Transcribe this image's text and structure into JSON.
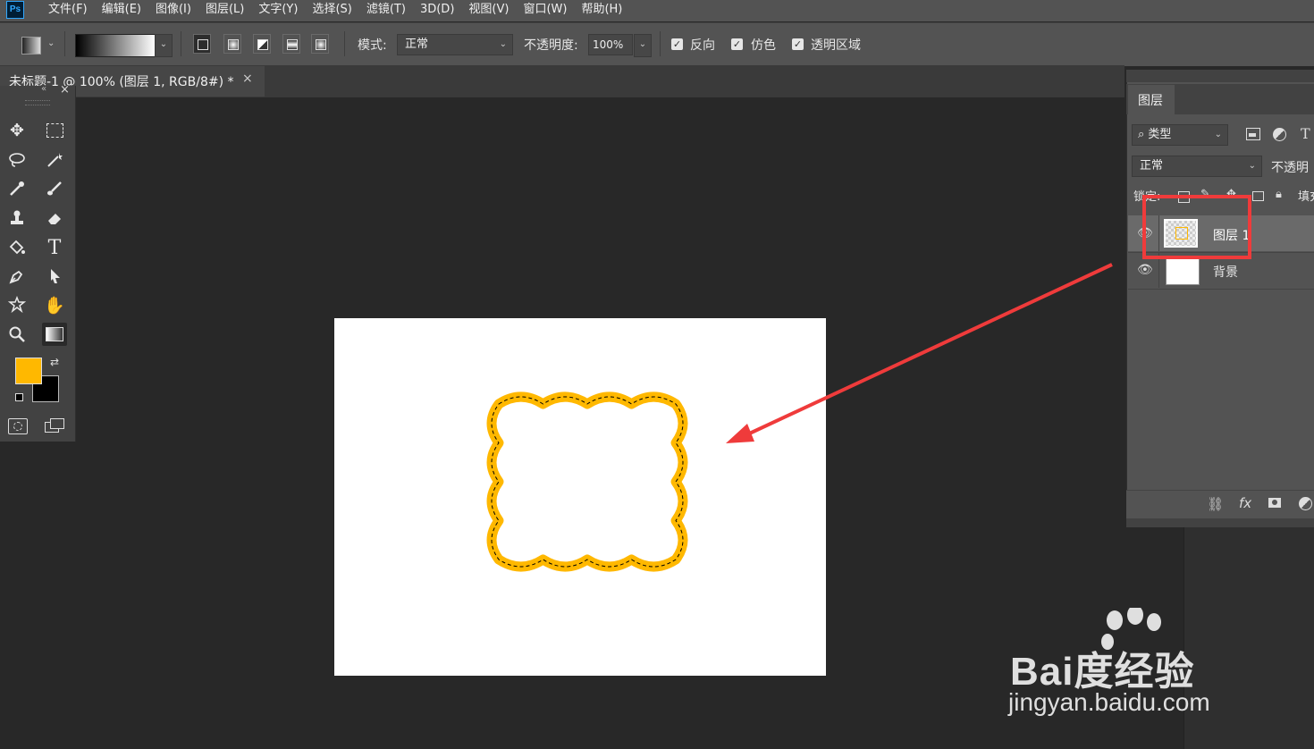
{
  "app": {
    "logo_text": "Ps"
  },
  "menu": {
    "items": [
      "文件(F)",
      "编辑(E)",
      "图像(I)",
      "图层(L)",
      "文字(Y)",
      "选择(S)",
      "滤镜(T)",
      "3D(D)",
      "视图(V)",
      "窗口(W)",
      "帮助(H)"
    ]
  },
  "options": {
    "mode_label": "模式:",
    "mode_value": "正常",
    "opacity_label": "不透明度:",
    "opacity_value": "100%",
    "reverse_label": "反向",
    "dither_label": "仿色",
    "transparency_label": "透明区域"
  },
  "document": {
    "tab_label": "未标题-1 @ 100% (图层 1, RGB/8#) *",
    "close_glyph": "×"
  },
  "toolbox": {
    "close_glyph": "×",
    "collapse_glyph": "«",
    "foreground_color": "#FFB800",
    "background_color": "#000000"
  },
  "canvas": {
    "shape_stroke_color": "#FFB800"
  },
  "layers_panel": {
    "tab_label": "图层",
    "filter_label": "类型",
    "blend_mode": "正常",
    "opacity_label": "不透明",
    "lock_label": "锁定:",
    "fill_label": "填充",
    "layers": [
      {
        "name": "图层 1",
        "selected": true
      },
      {
        "name": "背景",
        "selected": false
      }
    ],
    "fx_label": "fx"
  },
  "annotation": {
    "arrow_color": "#EF3B3B"
  },
  "watermark": {
    "logo": "Bai度经验",
    "url": "jingyan.baidu.com"
  }
}
